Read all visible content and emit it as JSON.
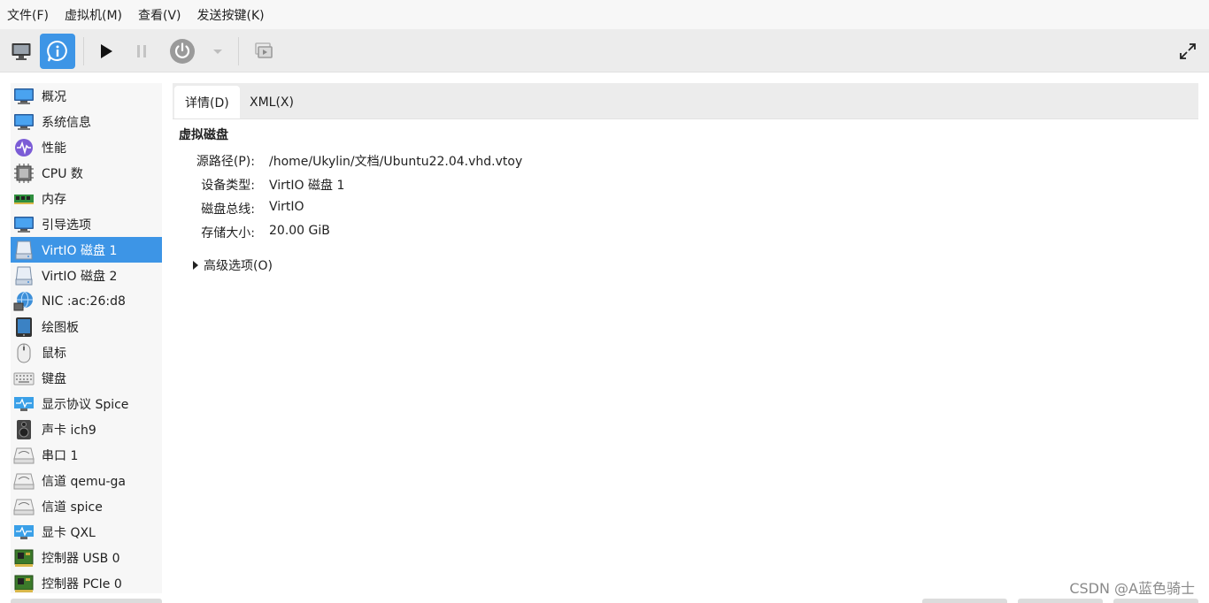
{
  "menu": [
    "文件(F)",
    "虚拟机(M)",
    "查看(V)",
    "发送按键(K)"
  ],
  "toolbar": {
    "buttons": [
      {
        "name": "console-view",
        "icon": "monitor-icon"
      },
      {
        "name": "details-view",
        "icon": "info-icon",
        "active": true
      },
      {
        "name": "run",
        "icon": "play-icon"
      },
      {
        "name": "pause",
        "icon": "pause-icon"
      },
      {
        "name": "shutdown",
        "icon": "power-icon"
      },
      {
        "name": "shutdown-menu",
        "icon": "chevron-down-icon"
      },
      {
        "name": "snapshots",
        "icon": "snapshot-icon"
      },
      {
        "name": "fullscreen",
        "icon": "fullscreen-icon"
      }
    ]
  },
  "sidebar": {
    "items": [
      {
        "label": "概况",
        "icon": "monitor-icon"
      },
      {
        "label": "系统信息",
        "icon": "monitor-icon"
      },
      {
        "label": "性能",
        "icon": "performance-icon"
      },
      {
        "label": "CPU 数",
        "icon": "cpu-icon"
      },
      {
        "label": "内存",
        "icon": "memory-icon"
      },
      {
        "label": "引导选项",
        "icon": "monitor-icon"
      },
      {
        "label": "VirtIO 磁盘 1",
        "icon": "disk-icon",
        "selected": true
      },
      {
        "label": "VirtIO 磁盘 2",
        "icon": "disk-icon"
      },
      {
        "label": "NIC :ac:26:d8",
        "icon": "network-icon"
      },
      {
        "label": "绘图板",
        "icon": "tablet-icon"
      },
      {
        "label": "鼠标",
        "icon": "mouse-icon"
      },
      {
        "label": "键盘",
        "icon": "keyboard-icon"
      },
      {
        "label": "显示协议 Spice",
        "icon": "display-icon"
      },
      {
        "label": "声卡 ich9",
        "icon": "speaker-icon"
      },
      {
        "label": "串口 1",
        "icon": "serial-icon"
      },
      {
        "label": "信道 qemu-ga",
        "icon": "serial-icon"
      },
      {
        "label": "信道 spice",
        "icon": "serial-icon"
      },
      {
        "label": "显卡 QXL",
        "icon": "display-icon"
      },
      {
        "label": "控制器 USB 0",
        "icon": "controller-icon"
      },
      {
        "label": "控制器 PCIe 0",
        "icon": "controller-icon"
      }
    ]
  },
  "tabs": [
    {
      "label": "详情(D)",
      "active": true
    },
    {
      "label": "XML(X)"
    }
  ],
  "details": {
    "title": "虚拟磁盘",
    "rows": [
      {
        "label": "源路径(P):",
        "value": "/home/Ukylin/文档/Ubuntu22.04.vhd.vtoy"
      },
      {
        "label": "设备类型:",
        "value": "VirtIO 磁盘 1"
      },
      {
        "label": "磁盘总线:",
        "value": "VirtIO"
      },
      {
        "label": "存储大小:",
        "value": "20.00 GiB"
      }
    ],
    "advanced_label": "高级选项(O)"
  },
  "watermark": "CSDN @A蓝色骑士",
  "colors": {
    "accent": "#3d95e6",
    "sidebar_bg": "#f7f7f7",
    "toolbar_bg": "#ececec"
  }
}
